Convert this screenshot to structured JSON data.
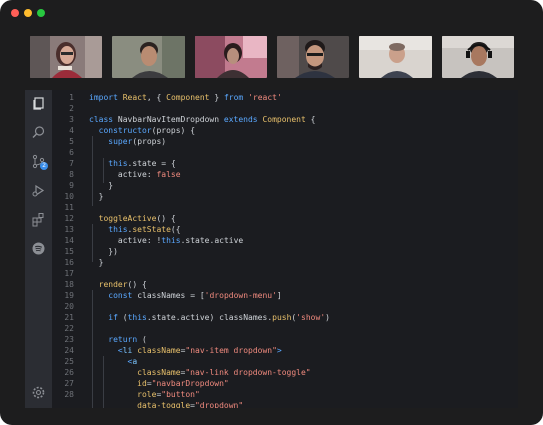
{
  "window": {
    "controls": [
      "close",
      "minimize",
      "zoom"
    ]
  },
  "video_tiles": [
    {
      "participant": "participant-1"
    },
    {
      "participant": "participant-2"
    },
    {
      "participant": "participant-3"
    },
    {
      "participant": "participant-4"
    },
    {
      "participant": "participant-5"
    },
    {
      "participant": "participant-6"
    }
  ],
  "activity_bar": {
    "icons": [
      "files-icon",
      "search-icon",
      "source-control-icon",
      "run-debug-icon",
      "extensions-icon",
      "spotify-icon",
      "settings-gear-icon"
    ],
    "source_control_badge": "2"
  },
  "editor": {
    "line_numbers": [
      "1",
      "2",
      "3",
      "4",
      "5",
      "6",
      "7",
      "8",
      "9",
      "10",
      "11",
      "12",
      "13",
      "14",
      "15",
      "16",
      "17",
      "18",
      "19",
      "20",
      "21",
      "22",
      "23",
      "24",
      "25",
      "26",
      "27",
      "28"
    ],
    "lines": [
      "import React, { Component } from 'react'",
      "",
      "class NavbarNavItemDropdown extends Component {",
      "  constructor(props) {",
      "    super(props)",
      "",
      "    this.state = {",
      "      active: false",
      "    }",
      "  }",
      "",
      "  toggleActive() {",
      "    this.setState({",
      "      active: !this.state.active",
      "    })",
      "  }",
      "",
      "  render() {",
      "    const classNames = ['dropdown-menu']",
      "",
      "    if (this.state.active) classNames.push('show')",
      "",
      "    return (",
      "      <li className=\"nav-item dropdown\">",
      "        <a",
      "          className=\"nav-link dropdown-toggle\"",
      "          id=\"navbarDropdown\"",
      "          role=\"button\"",
      "          data-toggle=\"dropdown\""
    ]
  },
  "colors": {
    "keyword": "#5aa8ff",
    "type": "#e8c06b",
    "string": "#f08a7e",
    "plain": "#cfd3d8",
    "line_number": "#6e7177"
  }
}
